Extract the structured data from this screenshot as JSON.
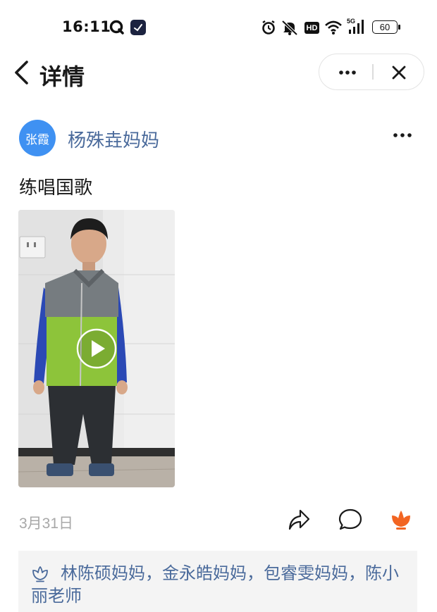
{
  "status_bar": {
    "time": "16:11",
    "battery": "60",
    "network": "5G",
    "hd_label": "HD"
  },
  "nav": {
    "title": "详情"
  },
  "post": {
    "avatar_text": "张霞",
    "avatar_color": "#3f91f2",
    "author": "杨殊垚妈妈",
    "content": "练唱国歌",
    "date": "3月31日",
    "likes_text": "林陈硕妈妈，金永皓妈妈，包睿雯妈妈，陈小丽老师"
  },
  "colors": {
    "link": "#4a6a9b",
    "like_active": "#f26522",
    "date": "#a8a8a8",
    "likes_bg": "#f4f4f4"
  },
  "icons": {
    "back": "chevron-left-icon",
    "more": "more-dots-icon",
    "close": "close-icon",
    "play": "play-icon",
    "share": "share-icon",
    "comment": "comment-icon",
    "like": "flower-like-icon"
  }
}
